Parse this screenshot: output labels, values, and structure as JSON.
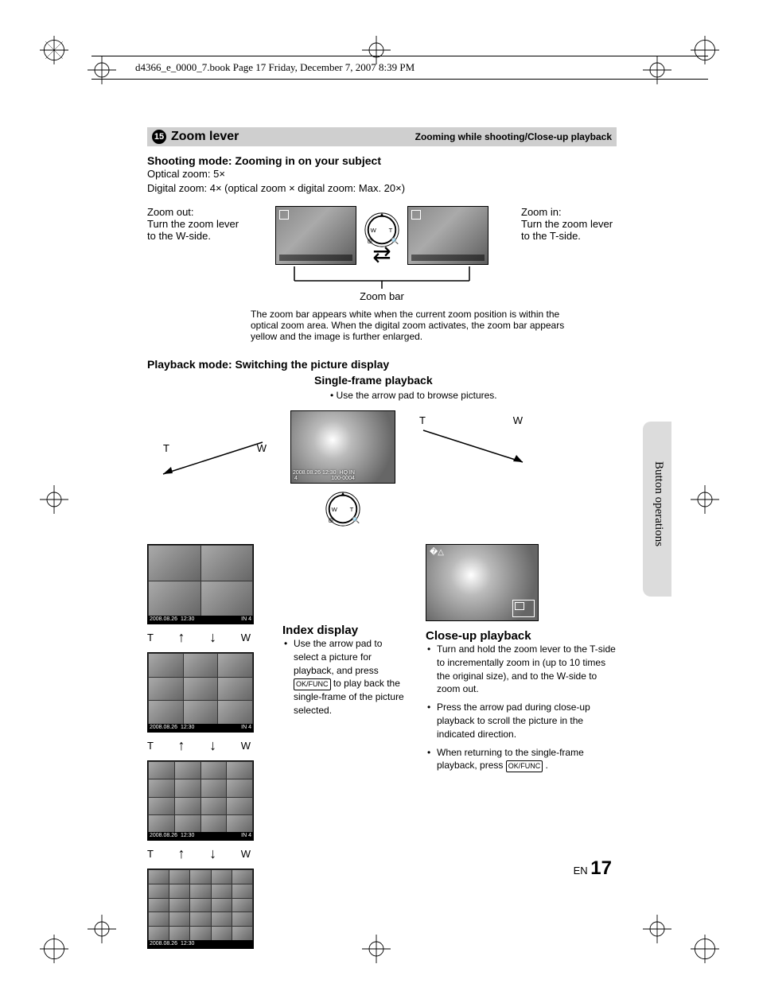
{
  "header": "d4366_e_0000_7.book  Page 17  Friday, December 7, 2007  8:39 PM",
  "section_number": "15",
  "section_title": "Zoom lever",
  "section_subtitle": "Zooming while shooting/Close-up playback",
  "shooting": {
    "heading": "Shooting mode: Zooming in on your subject",
    "optical": "Optical zoom: 5×",
    "digital": "Digital zoom: 4× (optical zoom × digital zoom: Max. 20×)",
    "zoom_out": "Zoom out:\nTurn the zoom lever to the W-side.",
    "zoom_in": "Zoom in:\nTurn the zoom lever to the T-side.",
    "zoom_bar_label": "Zoom bar",
    "zoom_bar_note": "The zoom bar appears white when the current zoom position is within the optical zoom area. When the digital zoom activates, the zoom bar appears yellow and the image is further enlarged."
  },
  "playback": {
    "heading": "Playback mode: Switching the picture display",
    "single_frame": "Single-frame playback",
    "single_note": "Use the arrow pad to browse pictures.",
    "labels": {
      "T": "T",
      "W": "W"
    },
    "overlay": {
      "date": "2008.08.26",
      "time": "12:30",
      "in": "IN",
      "count": "4",
      "hq": "HQ",
      "frame": "100-0004"
    },
    "index": {
      "heading": "Index display",
      "text": "Use the arrow pad to select a picture for playback, and press        to play back the single-frame of the picture selected.",
      "ok": "OK/FUNC"
    },
    "closeup": {
      "heading": "Close-up playback",
      "b1": "Turn and hold the zoom lever to the T-side to incrementally zoom in (up to 10 times the original size), and to the W-side to zoom out.",
      "b2": "Press the arrow pad during close-up playback to scroll the picture in the indicated direction.",
      "b3": "When returning to the single-frame playback, press        .",
      "ok": "OK/FUNC"
    }
  },
  "side_label": "Button operations",
  "page_lang": "EN",
  "page_number": "17"
}
